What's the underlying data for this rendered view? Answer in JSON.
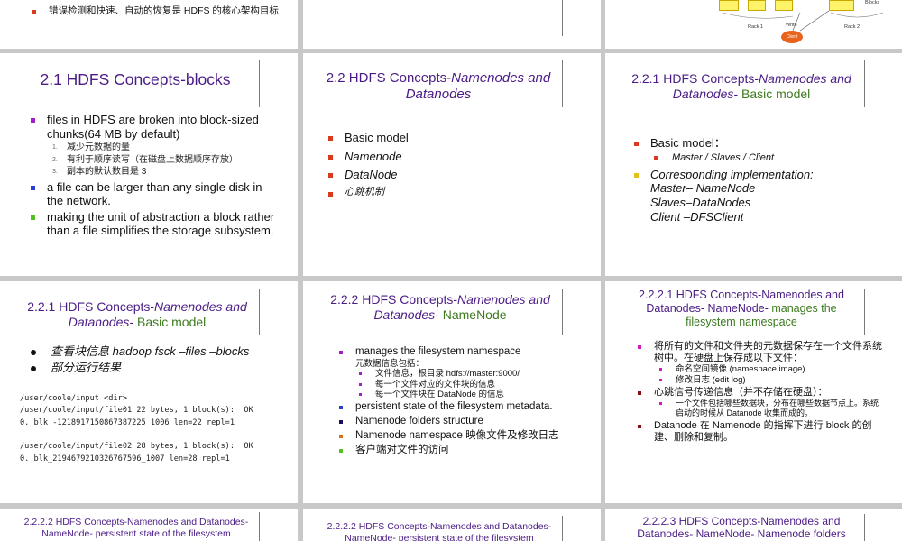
{
  "slide0": {
    "items": [
      "错误检测和快速、自动的恢复是 HDFS 的核心架构目标"
    ]
  },
  "slide2": {
    "rack1": "Rack 1",
    "rack2": "Rack 2",
    "write": "Write",
    "client": "Client",
    "blocks": "Blocks"
  },
  "slide3": {
    "title": "2.1 HDFS Concepts-blocks",
    "item1": "files in HDFS are broken into block-sized chunks(64 MB by default)",
    "sub_items": [
      {
        "num": "1.",
        "text": "减少元数据的量"
      },
      {
        "num": "2.",
        "text": "有利于顺序读写（在磁盘上数据顺序存放）"
      },
      {
        "num": "3.",
        "text": "副本的默认数目是 3"
      }
    ],
    "item2": "a file can be larger than any single disk in the network.",
    "item3": "making the unit of abstraction a block rather than a file simplifies the storage subsystem."
  },
  "slide4": {
    "title_plain": "2.2 HDFS Concepts-",
    "title_italic": "Namenodes and Datanodes",
    "items": [
      "Basic model",
      "Namenode",
      "DataNode",
      "心跳机制"
    ]
  },
  "slide5": {
    "title_plain": "2.2.1 HDFS Concepts-",
    "title_italic": "Namenodes and Datanodes",
    "title_dash": "- ",
    "title_green": "Basic model",
    "item1": "Basic model：",
    "sub1": "Master / Slaves / Client",
    "item2_lines": [
      "Corresponding implementation:",
      "Master– NameNode",
      "Slaves–DataNodes",
      "Client –DFSClient"
    ]
  },
  "slide6": {
    "title_plain": "2.2.1 HDFS Concepts-",
    "title_italic": "Namenodes and Datanodes",
    "title_dash": "- ",
    "title_green": "Basic model",
    "items": [
      "查看块信息 hadoop fsck –files –blocks",
      "部分运行结果"
    ],
    "code": "/user/coole/input <dir>\n/user/coole/input/file01 22 bytes, 1 block(s):  OK\n0. blk_-1218917150867387225_1006 len=22 repl=1\n\n/user/coole/input/file02 28 bytes, 1 block(s):  OK\n0. blk_2194679210326767596_1007 len=28 repl=1"
  },
  "slide7": {
    "title_plain": "2.2.2 HDFS Concepts-",
    "title_italic": "Namenodes and Datanodes",
    "title_dash": "- ",
    "title_green": "NameNode",
    "item1": "manages the filesystem namespace",
    "item1_note": "元数据信息包括：",
    "subs": [
      "文件信息，根目录  hdfs://master:9000/",
      "每一个文件对应的文件块的信息",
      "每一个文件块在 DataNode 的信息"
    ],
    "item2": "persistent state of the filesystem metadata.",
    "item3": "Namenode folders structure",
    "item4": "Namenode namespace 映像文件及修改日志",
    "item5": "客户端对文件的访问"
  },
  "slide8": {
    "title_plain": "2.2.2.1 HDFS Concepts-Namenodes and Datanodes- NameNode- ",
    "title_green": "manages the filesystem namespace",
    "item1": "将所有的文件和文件夹的元数据保存在一个文件系统树中。在硬盘上保存成以下文件：",
    "subs1": [
      "命名空间镜像 (namespace image)",
      "修改日志 (edit log)"
    ],
    "item2": "心跳信号传递信息（并不存储在硬盘）：",
    "subs2": [
      "一个文件包括哪些数据块，分布在哪些数据节点上。系统启动的时候从 Datanode 收集而成的。"
    ],
    "item3": "Datanode 在 Namenode 的指挥下进行 block 的创建、删除和复制。"
  },
  "slide9": {
    "title": "2.2.2.2 HDFS Concepts-Namenodes and Datanodes- NameNode- persistent state of the filesystem"
  },
  "slide10": {
    "title": "2.2.2.2 HDFS Concepts-Namenodes and Datanodes- NameNode- persistent state of the filesystem"
  },
  "slide11": {
    "title": "2.2.2.3 HDFS Concepts-Namenodes and Datanodes- NameNode- Namenode folders"
  }
}
